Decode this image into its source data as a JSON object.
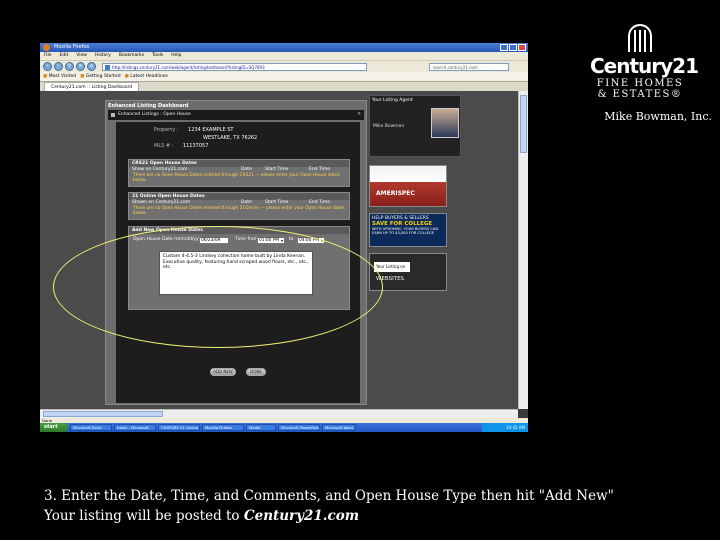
{
  "browser": {
    "title": "Mozilla Firefox",
    "menu": [
      "File",
      "Edit",
      "View",
      "History",
      "Bookmarks",
      "Tools",
      "Help"
    ],
    "url": "http://listings.century21.com/web/agent/listingdashboard?listingID=SQ7893",
    "search": "search.century21.com",
    "bookmarks": [
      "Most Visited",
      "Getting Started",
      "Latest Headlines"
    ],
    "tab": "Century21.com :: Listing Dashboard",
    "status": "Done",
    "footer_url": "http://listings.century21.com/web/agent/listing/addopenhouse?listingID=SQ7893&type=new"
  },
  "dashboard": {
    "title": "Enhanced Listing Dashboard",
    "subtitle": "Enhanced Listings : Open House",
    "property_label": "Property :",
    "property_value": "1234 EXAMPLE ST",
    "address_value": "WESTLAKE, TX 76262",
    "mls_label": "MLS # :",
    "mls_value": "11137057"
  },
  "sections": {
    "c21": {
      "title": "CRS21 Open House Dates",
      "show_label": "Show on Century21.com",
      "cols": [
        "Date",
        "Start Time",
        "End Time"
      ],
      "warning": "There are no Open House Dates entered through CRS21 — please enter your Open House dates below."
    },
    "c21only": {
      "title": "21 Online Open House Dates",
      "show_label": "Shown on Century21.com",
      "cols": [
        "Date",
        "Start Time",
        "End Time"
      ],
      "warning": "There are no Open House Dates entered through 21Online — please enter your Open House dates below."
    },
    "add": {
      "title": "Add New Open House Dates",
      "date_label": "Open House Date (mm/dd/yy)",
      "date_value": "06/23/09",
      "time_label": "Time from",
      "start_value": "01:00 PM",
      "to_label": "to",
      "end_value": "04:00 PM",
      "comments": "Custom 4-4.5-3 Lindsey collection home built by Linda Keenan. Executive quality, featuring hand scraped wood floors, etc., etc., etc."
    }
  },
  "buttons": {
    "add_new": "ADD NEW",
    "done": "DONE"
  },
  "agent": {
    "heading": "Your Listing Agent",
    "name": "Mike Bowman"
  },
  "ads": {
    "amerispec": "AMERISPEC",
    "college_top": "HELP BUYERS & SELLERS",
    "college_big": "SAVE FOR COLLEGE",
    "college_small": "WITH UPROMISE, YOUR BUYERS CAN EARN UP TO $3,000 FOR COLLEGE",
    "sites_box": "Your Listing on Century21.com",
    "sites_label": "WEBSITES"
  },
  "taskbar": {
    "start": "start",
    "tasks": [
      "Microsoft Excel",
      "Inbox - Microsoft",
      "CENTURY 21 Online",
      "Mozilla Firefox",
      "Media",
      "Microsoft PowerPoint",
      "Microsoft Word"
    ],
    "clock": "10:42 AM"
  },
  "logo": {
    "brand": "Century21",
    "line1": "FINE HOMES",
    "line2": "& ESTATES®",
    "office": "Mike Bowman, Inc."
  },
  "caption": {
    "line1": "3. Enter the Date, Time, and Comments, and Open House Type then hit \"Add New\"",
    "line2_prefix": "Your listing will be posted to ",
    "line2_site": "Century21.com"
  },
  "colors": {
    "highlight": "#f0f070",
    "warning": "#ffd24a"
  }
}
